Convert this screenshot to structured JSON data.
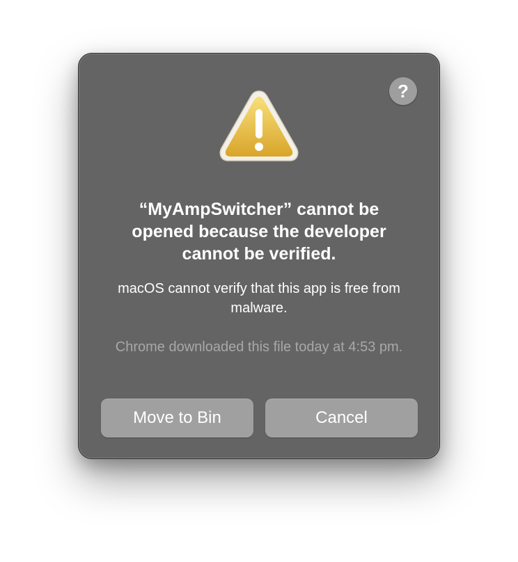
{
  "dialog": {
    "help_icon": "question-mark-icon",
    "help_label": "?",
    "warning_icon": "warning-triangle-icon",
    "title": "“MyAmpSwitcher” cannot be opened because the developer cannot be verified.",
    "message": "macOS cannot verify that this app is free from malware.",
    "info": "Chrome downloaded this file today at 4:53 pm.",
    "buttons": {
      "move_to_bin": "Move to Bin",
      "cancel": "Cancel"
    }
  },
  "colors": {
    "dialog_background": "#646464",
    "button_background": "#a0a0a0",
    "warning_yellow": "#e9b93a",
    "secondary_text": "#a8a8a8"
  }
}
